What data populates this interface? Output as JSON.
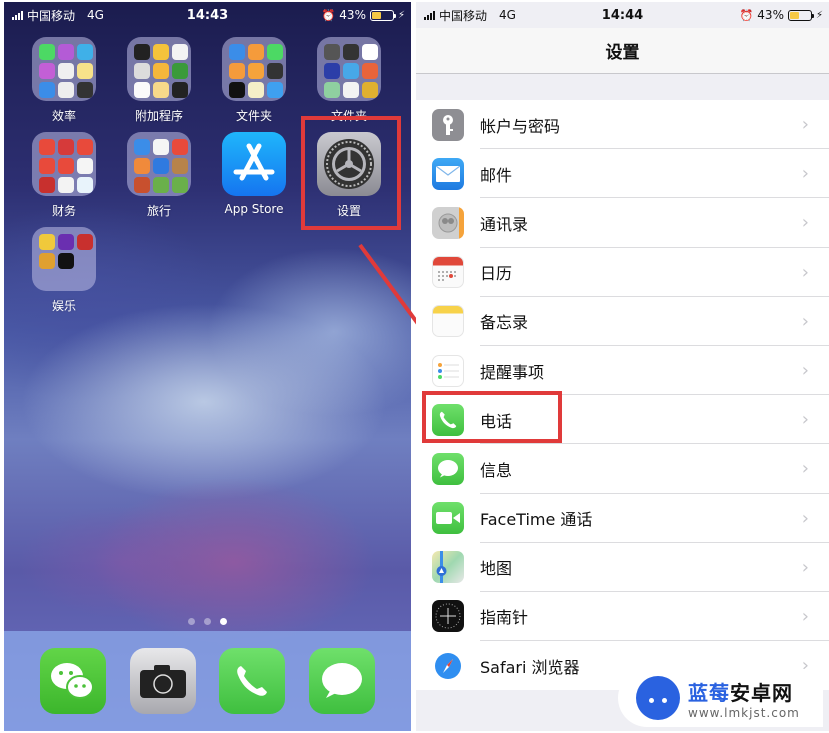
{
  "left_screen": {
    "status_bar": {
      "carrier": "中国移动",
      "network": "4G",
      "time": "14:43",
      "battery": "43%",
      "battery_level": 0.43
    },
    "apps": [
      {
        "label": "效率",
        "type": "folder"
      },
      {
        "label": "附加程序",
        "type": "folder"
      },
      {
        "label": "文件夹",
        "type": "folder"
      },
      {
        "label": "文件夹",
        "type": "folder"
      },
      {
        "label": "财务",
        "type": "folder"
      },
      {
        "label": "旅行",
        "type": "folder"
      },
      {
        "label": "App Store",
        "type": "app",
        "icon": "app-store-icon"
      },
      {
        "label": "设置",
        "type": "app",
        "icon": "settings-gear-icon",
        "highlighted": true
      },
      {
        "label": "娱乐",
        "type": "folder"
      }
    ],
    "page_dots": {
      "count": 3,
      "active": 3
    },
    "dock": [
      {
        "name": "WeChat",
        "icon": "wechat-icon"
      },
      {
        "name": "Camera",
        "icon": "camera-icon"
      },
      {
        "name": "Phone",
        "icon": "phone-icon"
      },
      {
        "name": "Messages",
        "icon": "messages-icon"
      }
    ]
  },
  "right_screen": {
    "status_bar": {
      "carrier": "中国移动",
      "network": "4G",
      "time": "14:44",
      "battery": "43%",
      "battery_level": 0.43
    },
    "title": "设置",
    "items": [
      {
        "label": "帐户与密码",
        "icon": "key-icon",
        "color": "#8e8e93"
      },
      {
        "label": "邮件",
        "icon": "mail-icon",
        "color": "#2f8ef0"
      },
      {
        "label": "通讯录",
        "icon": "contacts-icon",
        "color": "#bdbdbd"
      },
      {
        "label": "日历",
        "icon": "calendar-icon",
        "color": "#ffffff"
      },
      {
        "label": "备忘录",
        "icon": "notes-icon",
        "color": "#f7d24a"
      },
      {
        "label": "提醒事项",
        "icon": "reminders-icon",
        "color": "#ffffff"
      },
      {
        "label": "电话",
        "icon": "phone-icon",
        "color": "#4cd964",
        "highlighted": true
      },
      {
        "label": "信息",
        "icon": "messages-icon",
        "color": "#4cd964"
      },
      {
        "label": "FaceTime 通话",
        "icon": "facetime-icon",
        "color": "#4cd964"
      },
      {
        "label": "地图",
        "icon": "maps-icon",
        "color": "#7fc8a0"
      },
      {
        "label": "指南针",
        "icon": "compass-icon",
        "color": "#111111"
      },
      {
        "label": "Safari 浏览器",
        "icon": "safari-icon",
        "color": "#2f8ef0"
      }
    ]
  },
  "annotation": {
    "color": "#e03a3a",
    "arrow_from": "设置",
    "arrow_to": "电话"
  },
  "watermark": {
    "brand_part1": "蓝莓",
    "brand_part2": "安卓网",
    "url": "www.lmkjst.com"
  }
}
